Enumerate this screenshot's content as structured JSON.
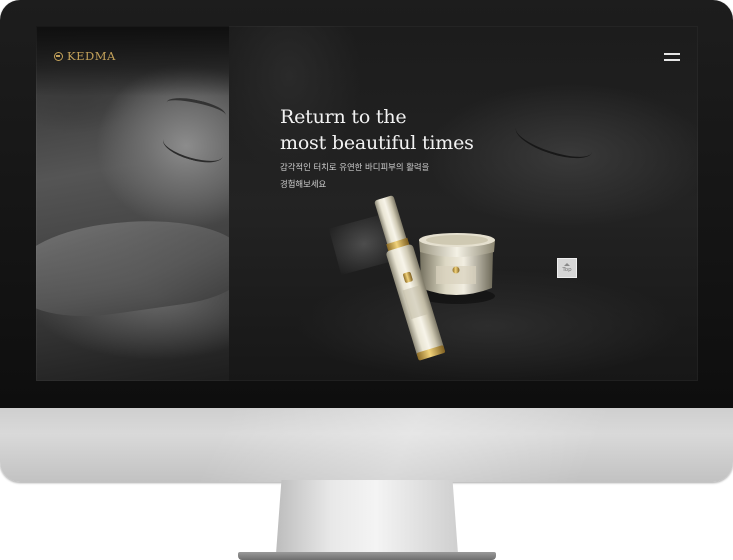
{
  "brand": {
    "name": "KEDMA",
    "accent_color": "#c4a25a"
  },
  "header": {
    "logo_icon": "kedma-logo-icon",
    "menu_icon": "hamburger-menu-icon"
  },
  "hero": {
    "headline_line1": "Return to the",
    "headline_line2": "most beautiful times",
    "subtext_line1": "감각적인 터치로 유연한 바디피부의 활력을",
    "subtext_line2": "경험해보세요",
    "product_image": "skincare-bottle-and-jar"
  },
  "scroll_top": {
    "label": "Top",
    "icon": "chevron-up-icon"
  }
}
